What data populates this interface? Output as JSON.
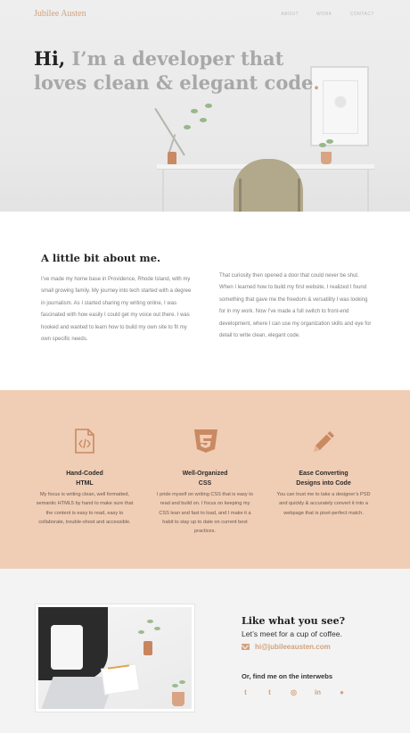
{
  "brand": {
    "logo": "Jubilee Austen",
    "accent": "#d2a27e"
  },
  "nav": {
    "items": [
      "ABOUT",
      "WORK",
      "CONTACT"
    ]
  },
  "hero": {
    "hi": "Hi,",
    "rest": "I’m a developer that loves clean & elegant code",
    "dot": "."
  },
  "about": {
    "title": "A little bit about me.",
    "paragraph1": "I’ve made my home base in Providence, Rhode Island, with my small growing family. My journey into tech started with a degree in journalism. As I started sharing my writing online, I was fascinated with how easily I could get my voice out there. I was hooked and wanted to learn how to build my own site to fit my own specific needs.",
    "paragraph2": "That curiosity then opened a door that could never be shut. When I learned how to build my first website, I realized I found something that gave me the freedom & versatility I was looking for in my work. Now I’ve made a full switch to front-end development, where I can use my organization skills and eye for detail to write clean, elegant code."
  },
  "skills": [
    {
      "icon": "code-file-icon",
      "title_line1": "Hand-Coded",
      "title_line2": "HTML",
      "text": "My focus is writing clean, well formatted, semantic HTML5 by hand to make sure that the content is easy to read, easy to collaborate, trouble-shoot and accessible."
    },
    {
      "icon": "css3-icon",
      "title_line1": "Well-Organized",
      "title_line2": "CSS",
      "text": "I pride myself on writing CSS that is easy to read and build on. I focus on keeping my CSS lean and fast to load, and I make it a habit to stay up to date on current best practices."
    },
    {
      "icon": "pencil-icon",
      "title_line1": "Ease Converting",
      "title_line2": "Designs into Code",
      "text": "You can trust me to take a designer’s PSD and quickly & accurately convert it into a webpage that is pixel-perfect match."
    }
  ],
  "contact": {
    "title": "Like what you see?",
    "subtitle": "Let’s meet for a cup of coffee.",
    "email": "hi@jubileeausten.com",
    "find_title": "Or, find me on the interwebs",
    "socials": [
      {
        "name": "twitter-icon",
        "glyph": "t"
      },
      {
        "name": "tumblr-icon",
        "glyph": "t"
      },
      {
        "name": "instagram-icon",
        "glyph": "◎"
      },
      {
        "name": "linkedin-icon",
        "glyph": "in"
      },
      {
        "name": "github-icon",
        "glyph": "●"
      }
    ]
  }
}
